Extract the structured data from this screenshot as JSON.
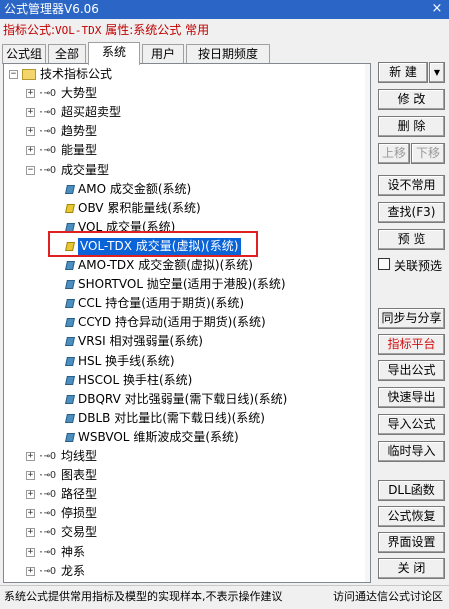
{
  "window": {
    "title": "公式管理器V6.06",
    "close_glyph": "×"
  },
  "info": {
    "prefix": "指标公式:",
    "code": "VOL-TDX",
    "suffix": "属性:系统公式 常用"
  },
  "tabs": [
    "公式组",
    "全部",
    "系统",
    "用户",
    "按日期频度"
  ],
  "active_tab": "系统",
  "tree": {
    "root": "技术指标公式",
    "groups_before": [
      "大势型",
      "超买超卖型",
      "趋势型",
      "能量型"
    ],
    "open_group": "成交量型",
    "items": [
      {
        "code": "AMO",
        "desc": "成交金额(系统)",
        "icon": "blue"
      },
      {
        "code": "OBV",
        "desc": "累积能量线(系统)",
        "icon": "yellow"
      },
      {
        "code": "VOL",
        "desc": "成交量(系统)",
        "icon": "blue"
      },
      {
        "code": "VOL-TDX",
        "desc": "成交量(虚拟)(系统)",
        "icon": "yellow",
        "selected": true
      },
      {
        "code": "AMO-TDX",
        "desc": "成交金额(虚拟)(系统)",
        "icon": "blue"
      },
      {
        "code": "SHORTVOL",
        "desc": "抛空量(适用于港股)(系统)",
        "icon": "blue"
      },
      {
        "code": "CCL",
        "desc": "持仓量(适用于期货)(系统)",
        "icon": "blue"
      },
      {
        "code": "CCYD",
        "desc": "持仓异动(适用于期货)(系统)",
        "icon": "blue"
      },
      {
        "code": "VRSI",
        "desc": "相对强弱量(系统)",
        "icon": "blue"
      },
      {
        "code": "HSL",
        "desc": "换手线(系统)",
        "icon": "blue"
      },
      {
        "code": "HSCOL",
        "desc": "换手柱(系统)",
        "icon": "blue"
      },
      {
        "code": "DBQRV",
        "desc": "对比强弱量(需下载日线)(系统)",
        "icon": "blue"
      },
      {
        "code": "DBLB",
        "desc": "对比量比(需下载日线)(系统)",
        "icon": "blue"
      },
      {
        "code": "WSBVOL",
        "desc": "维斯波成交量(系统)",
        "icon": "blue"
      }
    ],
    "groups_after": [
      "均线型",
      "图表型",
      "路径型",
      "停损型",
      "交易型",
      "神系",
      "龙系"
    ],
    "expander_plus": "+",
    "expander_minus": "−",
    "connector": "·⊸O"
  },
  "buttons": {
    "new": "新 建",
    "new_arrow": "▼",
    "modify": "修 改",
    "delete": "删 除",
    "up": "上移",
    "down": "下移",
    "set_uncommon": "设不常用",
    "find": "查找(F3)",
    "preview": "预 览",
    "linked_preview": "关联预选",
    "sync_share": "同步与分享",
    "indicator_platform": "指标平台",
    "export": "导出公式",
    "quick_export": "快速导出",
    "import": "导入公式",
    "temp_import": "临时导入",
    "dll": "DLL函数",
    "restore": "公式恢复",
    "ui_settings": "界面设置",
    "close": "关 闭"
  },
  "status": {
    "left": "系统公式提供常用指标及模型的实现样本,不表示操作建议",
    "right": "访问通达信公式讨论区"
  },
  "colors": {
    "title_bg": "#2b66c7",
    "selection": "#0a64d8",
    "highlight_border": "#e02020",
    "info_text": "#c00000"
  }
}
